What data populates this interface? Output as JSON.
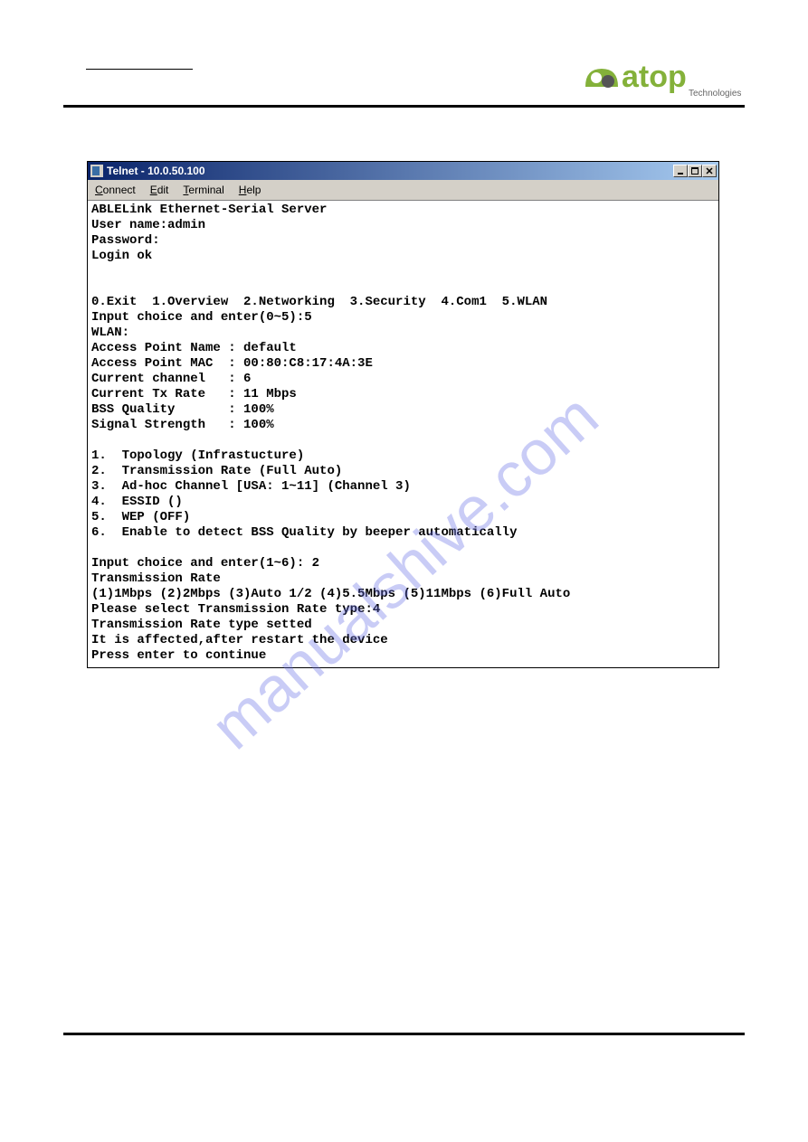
{
  "logo": {
    "text_main": "atop",
    "text_sub": "Technologies"
  },
  "window": {
    "title": "Telnet - 10.0.50.100",
    "win_buttons": {
      "min": "_",
      "max": "□",
      "close": "×"
    },
    "menus": {
      "connect": "Connect",
      "edit": "Edit",
      "terminal": "Terminal",
      "help": "Help"
    },
    "terminal_lines": [
      "ABLELink Ethernet-Serial Server",
      "User name:admin",
      "Password:",
      "Login ok",
      "",
      "",
      "0.Exit  1.Overview  2.Networking  3.Security  4.Com1  5.WLAN",
      "Input choice and enter(0~5):5",
      "WLAN:",
      "Access Point Name : default",
      "Access Point MAC  : 00:80:C8:17:4A:3E",
      "Current channel   : 6",
      "Current Tx Rate   : 11 Mbps",
      "BSS Quality       : 100%",
      "Signal Strength   : 100%",
      "",
      "1.  Topology (Infrastucture)",
      "2.  Transmission Rate (Full Auto)",
      "3.  Ad-hoc Channel [USA: 1~11] (Channel 3)",
      "4.  ESSID ()",
      "5.  WEP (OFF)",
      "6.  Enable to detect BSS Quality by beeper automatically",
      "",
      "Input choice and enter(1~6): 2",
      "Transmission Rate",
      "(1)1Mbps (2)2Mbps (3)Auto 1/2 (4)5.5Mbps (5)11Mbps (6)Full Auto",
      "Please select Transmission Rate type:4",
      "Transmission Rate type setted",
      "It is affected,after restart the device",
      "Press enter to continue"
    ]
  },
  "watermark": "manualshive.com"
}
